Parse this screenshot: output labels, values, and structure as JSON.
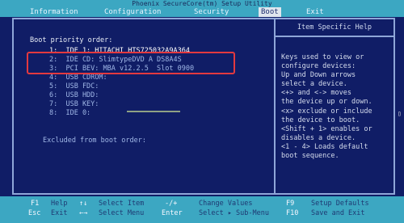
{
  "title": "Phoenix SecureCore(tm) Setup Utility",
  "menus": [
    "Information",
    "Configuration",
    "Security",
    "Boot",
    "Exit"
  ],
  "active_menu": "Boot",
  "boot": {
    "header": "Boot priority order:",
    "items": [
      "1:  IDE 1: HITACHI HTS725032A9A364",
      "2:  IDE CD: SlimtypeDVD A DS8A4S",
      "3:  PCI BEV: MBA v12.2.5  Slot 0900",
      "4:  USB CDROM:",
      "5:  USB FDC:",
      "6:  USB HDD:",
      "7:  USB KEY:",
      "8:  IDE 0:"
    ],
    "excluded_label": "Excluded from boot order:"
  },
  "help": {
    "title": "Item Specific Help",
    "lines": [
      "Keys used to view or",
      "configure devices:",
      "Up and Down arrows",
      "select a device.",
      "<+> and <-> moves",
      "the device up or down.",
      "<x> exclude or include",
      "the device to boot.",
      "<Shift + 1> enables or",
      "disables a device.",
      "<1 - 4> Loads default",
      "boot sequence."
    ]
  },
  "status": {
    "row1": [
      {
        "key": "F1",
        "desc": "Help"
      },
      {
        "key": "↑↓",
        "desc": "Select Item"
      },
      {
        "key": "-/+",
        "desc": "Change Values"
      },
      {
        "key": "F9",
        "desc": "Setup Defaults"
      }
    ],
    "row2": [
      {
        "key": "Esc",
        "desc": "Exit"
      },
      {
        "key": "←→",
        "desc": "Select Menu"
      },
      {
        "key": "Enter",
        "desc": "Select ▸ Sub-Menu"
      },
      {
        "key": "F10",
        "desc": "Save and Exit"
      }
    ]
  },
  "colors": {
    "background": "#101d66",
    "bar": "#3ca7c2",
    "highlight": "#e3393f"
  }
}
